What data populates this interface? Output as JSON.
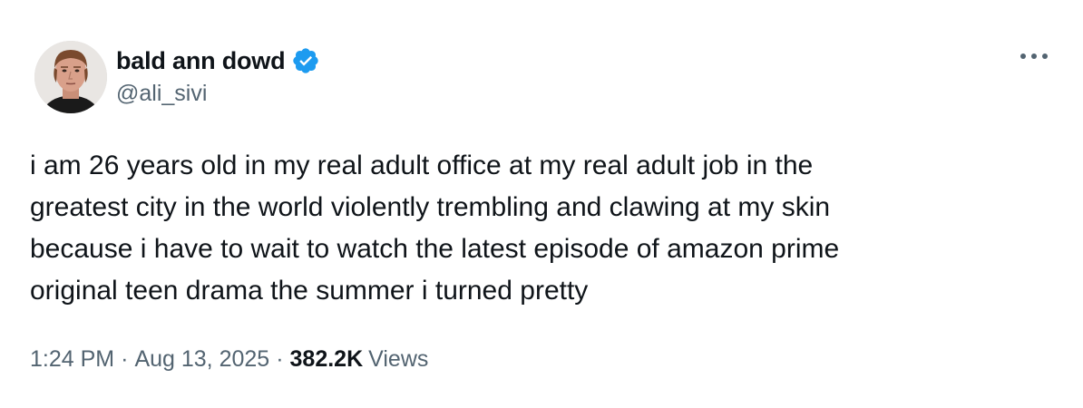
{
  "author": {
    "display_name": "bald ann dowd",
    "handle": "@ali_sivi",
    "verified": true
  },
  "icons": {
    "verified": "verified-badge-icon",
    "more": "more-options-icon"
  },
  "tweet": {
    "text": "i am 26 years old in my real adult office at my real adult job in the\ngreatest city in the world violently trembling and clawing at my skin\nbecause i have to wait to watch the latest episode of amazon prime\noriginal teen drama the summer i turned pretty"
  },
  "meta": {
    "time": "1:24 PM",
    "separator": "·",
    "date": "Aug 13, 2025",
    "views_count": "382.2K",
    "views_label": "Views"
  },
  "colors": {
    "verified_blue": "#1d9bf0",
    "secondary_text": "#536471",
    "primary_text": "#0f1419"
  }
}
